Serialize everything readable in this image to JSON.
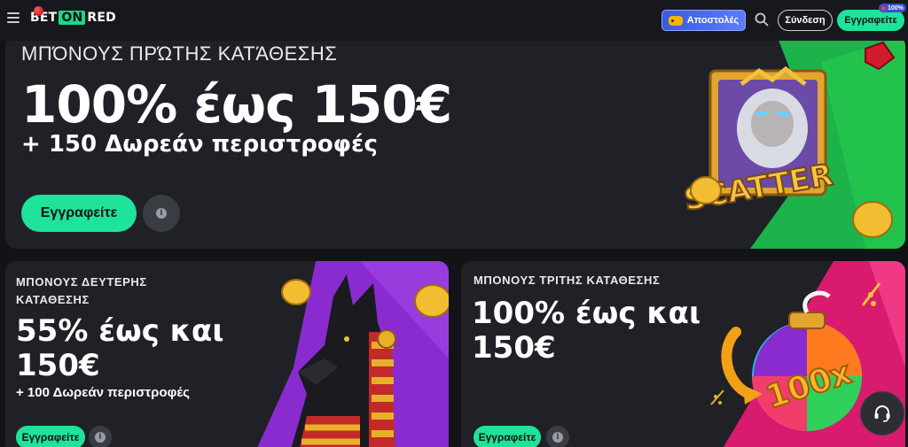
{
  "header": {
    "logo": {
      "part1": "BET",
      "part2": "ON",
      "part3": "RED"
    },
    "missions_label": "Αποστολές",
    "login_label": "Σύνδεση",
    "register_label": "Εγγραφείτε",
    "register_badge": "100%"
  },
  "promos": [
    {
      "eyebrow": "ΜΠΌΝΟΥΣ ΠΡΏΤΗΣ ΚΑΤΆΘΕΣΗΣ",
      "title": "100% έως 150€",
      "subtitle": "+ 150 Δωρεάν περιστροφές",
      "button_label": "Εγγραφείτε",
      "art_text": "SCATTER"
    },
    {
      "eyebrow": "ΜΠΟΝΟΥΣ ΔΕΥΤΕΡΗΣ ΚΑΤΑΘΕΣΗΣ",
      "title": "55% έως και 150€",
      "subtitle": "+ 100 Δωρεάν περιστροφές",
      "button_label": "Εγγραφείτε"
    },
    {
      "eyebrow": "ΜΠΟΝΟΥΣ ΤΡΙΤΗΣ ΚΑΤΑΘΕΣΗΣ",
      "title": "100% έως και 150€",
      "button_label": "Εγγραφείτε",
      "art_text": "100x"
    }
  ],
  "colors": {
    "accent": "#1fe39a",
    "brand_red": "#e53935",
    "missions": "#4f6ef7"
  }
}
